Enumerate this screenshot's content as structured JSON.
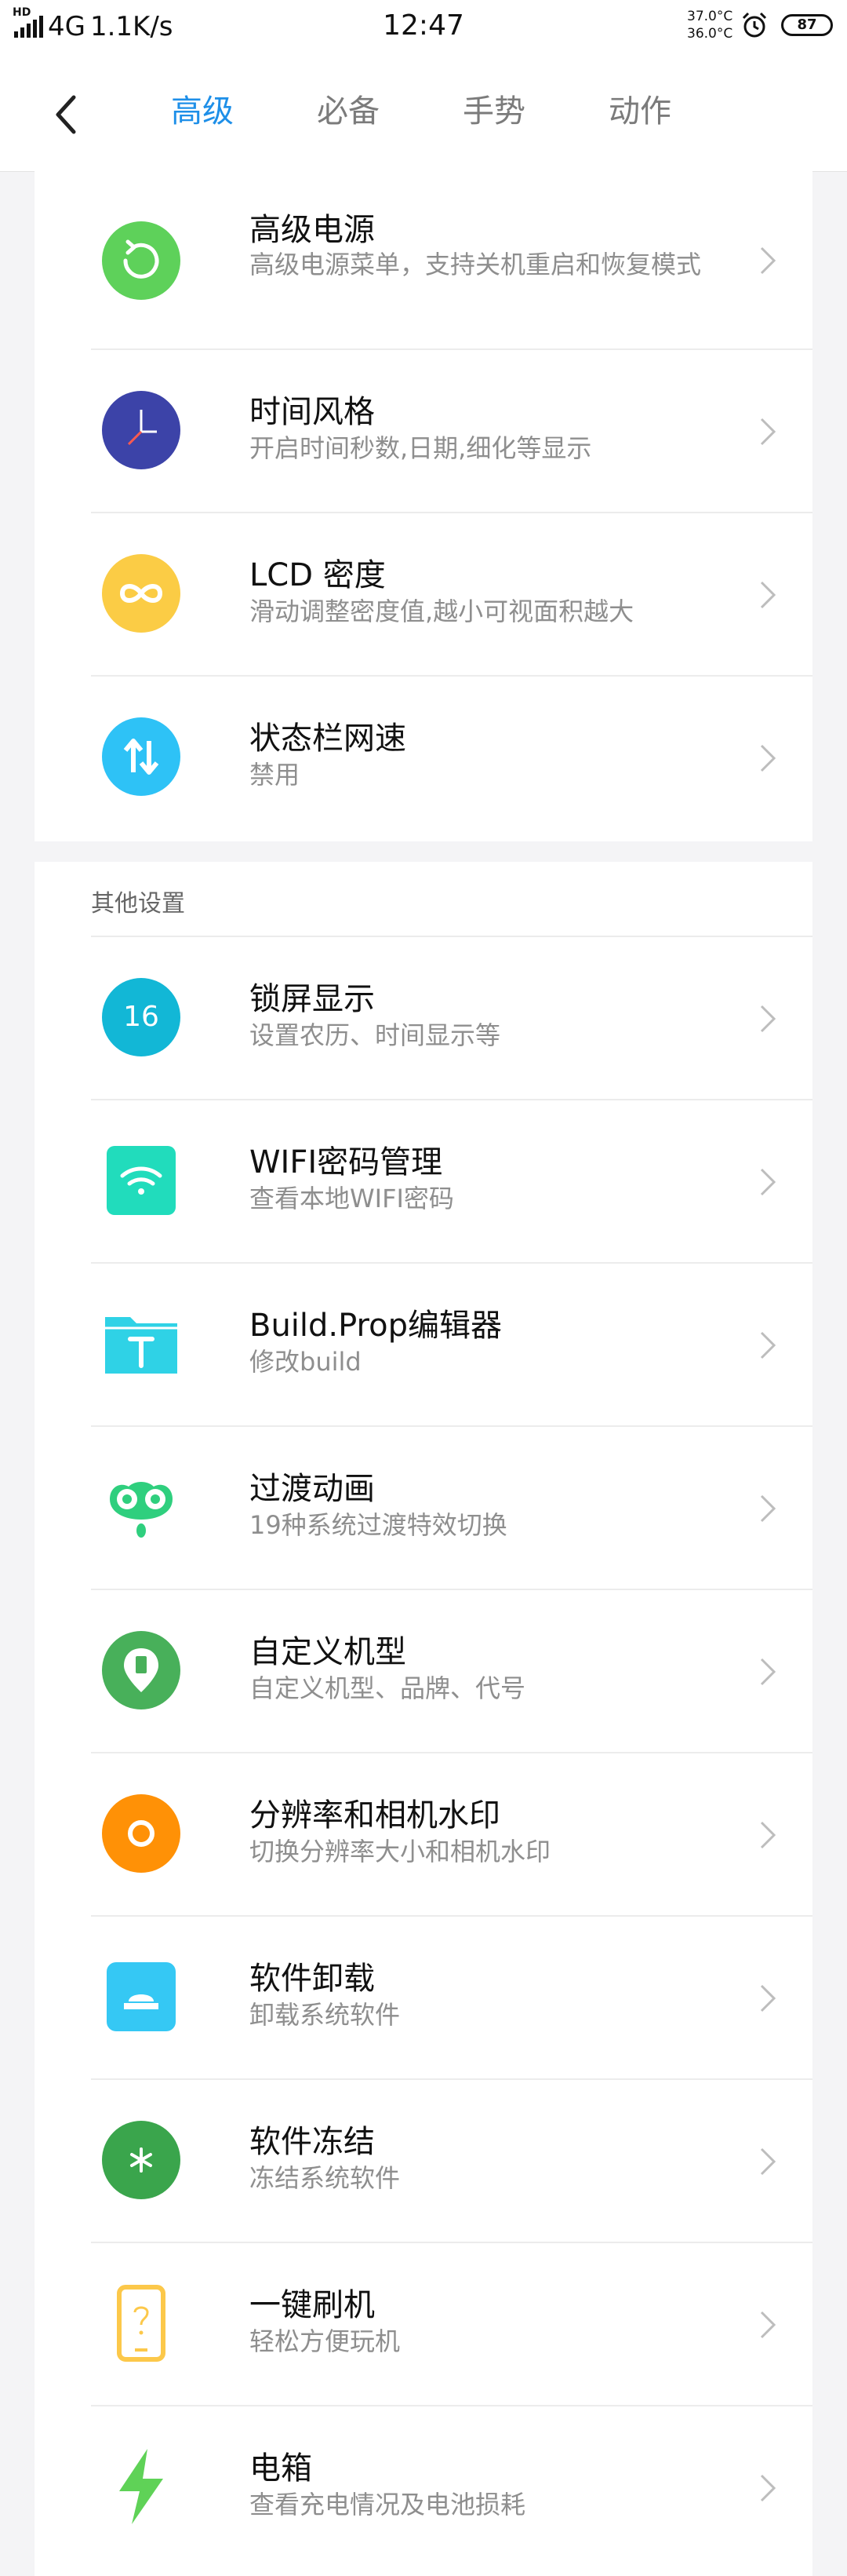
{
  "status_bar": {
    "hd_label": "HD",
    "network": "4G",
    "speed": "1.1K/s",
    "time": "12:47",
    "temp_high": "37.0°C",
    "temp_low": "36.0°C",
    "battery": "87"
  },
  "header": {
    "tabs": [
      {
        "label": "高级",
        "active": true
      },
      {
        "label": "必备",
        "active": false
      },
      {
        "label": "手势",
        "active": false
      },
      {
        "label": "动作",
        "active": false
      }
    ]
  },
  "advanced_items": [
    {
      "title": "高级电源",
      "subtitle": "高级电源菜单，支持关机重启和恢复模式",
      "icon": "power-refresh-icon",
      "color": "#5ed15a"
    },
    {
      "title": "时间风格",
      "subtitle": "开启时间秒数,日期,细化等显示",
      "icon": "clock-icon",
      "color": "#3c43a8"
    },
    {
      "title": "LCD 密度",
      "subtitle": "滑动调整密度值,越小可视面积越大",
      "icon": "infinity-icon",
      "color": "#fbcc45"
    },
    {
      "title": "状态栏网速",
      "subtitle": "禁用",
      "icon": "up-down-arrows-icon",
      "color": "#2ec2f6"
    }
  ],
  "other_section": {
    "title": "其他设置",
    "items": [
      {
        "title": "锁屏显示",
        "subtitle": "设置农历、时间显示等",
        "icon": "calendar-16-icon",
        "badge": "16",
        "color": "#12b7d6"
      },
      {
        "title": "WIFI密码管理",
        "subtitle": "查看本地WIFI密码",
        "icon": "wifi-icon",
        "color": "#21dcbc"
      },
      {
        "title": "Build.Prop编辑器",
        "subtitle": "修改build",
        "icon": "folder-hammer-icon",
        "color": "#2fd2e6"
      },
      {
        "title": "过渡动画",
        "subtitle": "19种系统过渡特效切换",
        "icon": "owl-eyes-icon",
        "color": "#2fcf7e"
      },
      {
        "title": "自定义机型",
        "subtitle": "自定义机型、品牌、代号",
        "icon": "phone-pin-icon",
        "color": "#48b05a"
      },
      {
        "title": "分辨率和相机水印",
        "subtitle": "切换分辨率大小和相机水印",
        "icon": "camera-ring-icon",
        "color": "#ff9106"
      },
      {
        "title": "软件卸载",
        "subtitle": "卸载系统软件",
        "icon": "uninstall-tray-icon",
        "color": "#35c8f4"
      },
      {
        "title": "软件冻结",
        "subtitle": "冻结系统软件",
        "icon": "snowflake-icon",
        "color": "#3aa54c"
      },
      {
        "title": "一键刷机",
        "subtitle": "轻松方便玩机",
        "icon": "phone-question-icon",
        "color": "#fcc84a"
      },
      {
        "title": "电箱",
        "subtitle": "查看充电情况及电池损耗",
        "icon": "lightning-icon",
        "color": "#5fd257"
      }
    ]
  }
}
